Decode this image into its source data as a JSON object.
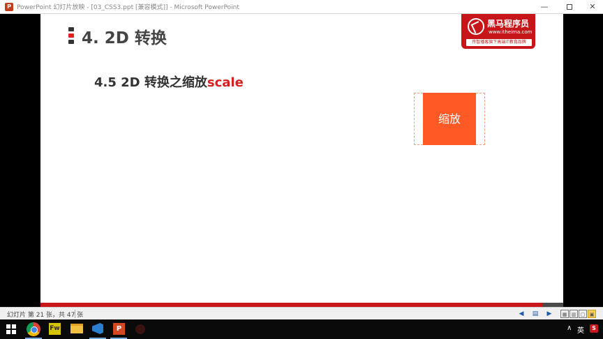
{
  "window": {
    "title": "PowerPoint 幻灯片放映 - [03_CSS3.ppt [兼容模式]] - Microsoft PowerPoint",
    "app_icon_letter": "P",
    "min_glyph": "—",
    "close_glyph": "✕"
  },
  "slide": {
    "title": "4. 2D 转换",
    "subtitle_prefix": "4.5 2D 转换之缩放",
    "subtitle_keyword": "scale",
    "demo_box_label": "缩放",
    "logo": {
      "brand": "黑马程序员",
      "url": "www.itheima.com",
      "slogan": "传智播客旗下高端IT教育品牌"
    },
    "progress": {
      "current": 21,
      "total": 47
    }
  },
  "statusbar": {
    "slide_info": "幻灯片 第 21 张，共 47 张",
    "icons": {
      "prev": "◀",
      "notes": "▤",
      "next": "▶",
      "normal_view": "▦",
      "sorter_view": "▥",
      "reading_view": "▢",
      "slideshow_view": "▣"
    }
  },
  "taskbar": {
    "fw_label": "Fw",
    "ppt_label": "P",
    "tray_arrow": "∧",
    "tray_lang": "英",
    "tray_app": "S"
  },
  "colors": {
    "accent_red": "#c8161a",
    "demo_orange": "#ff5a26"
  }
}
